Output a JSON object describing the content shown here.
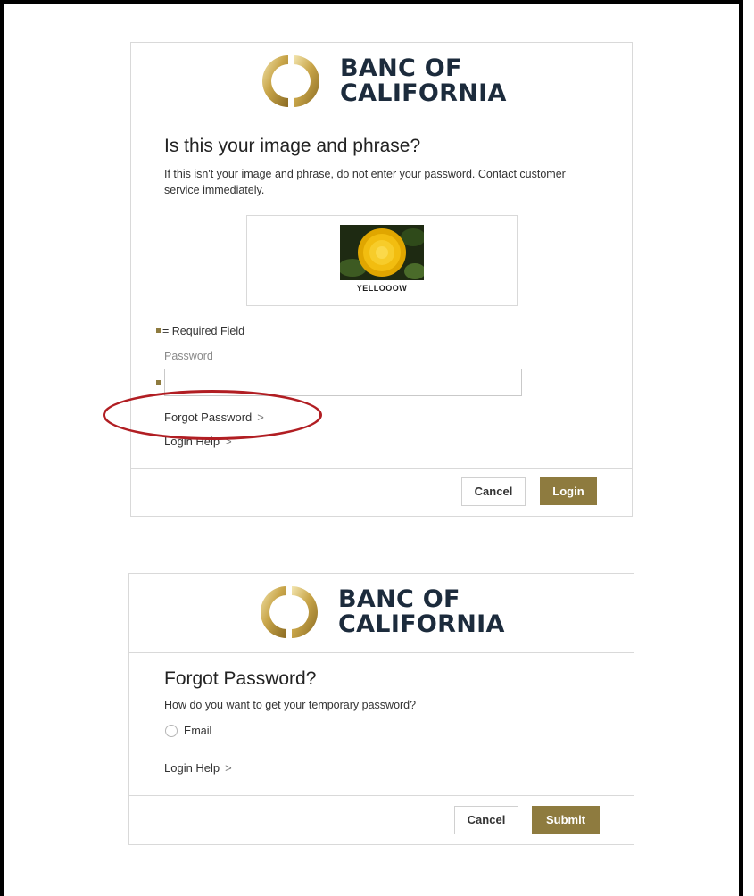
{
  "colors": {
    "accent": "#8e7b3f",
    "navy": "#1c2b3c",
    "annotation": "#b11e23"
  },
  "brand": {
    "line1": "BANC OF",
    "line2": "CALIFORNIA",
    "icon": "banc-of-california-ring-logo"
  },
  "login_card": {
    "title": "Is this your image and phrase?",
    "warning": "If this isn't your image and phrase, do not enter your password. Contact customer service immediately.",
    "security_image_caption": "YELLOOOW",
    "security_image_icon": "yellow-flower-image",
    "required_note": "= Required Field",
    "password_label": "Password",
    "password_value": "",
    "forgot_password_link": "Forgot Password",
    "login_help_link": "Login Help",
    "chevron": ">",
    "cancel_label": "Cancel",
    "login_label": "Login"
  },
  "forgot_card": {
    "title": "Forgot Password?",
    "question": "How do you want to get your temporary password?",
    "option_email": "Email",
    "login_help_link": "Login Help",
    "chevron": ">",
    "cancel_label": "Cancel",
    "submit_label": "Submit"
  }
}
